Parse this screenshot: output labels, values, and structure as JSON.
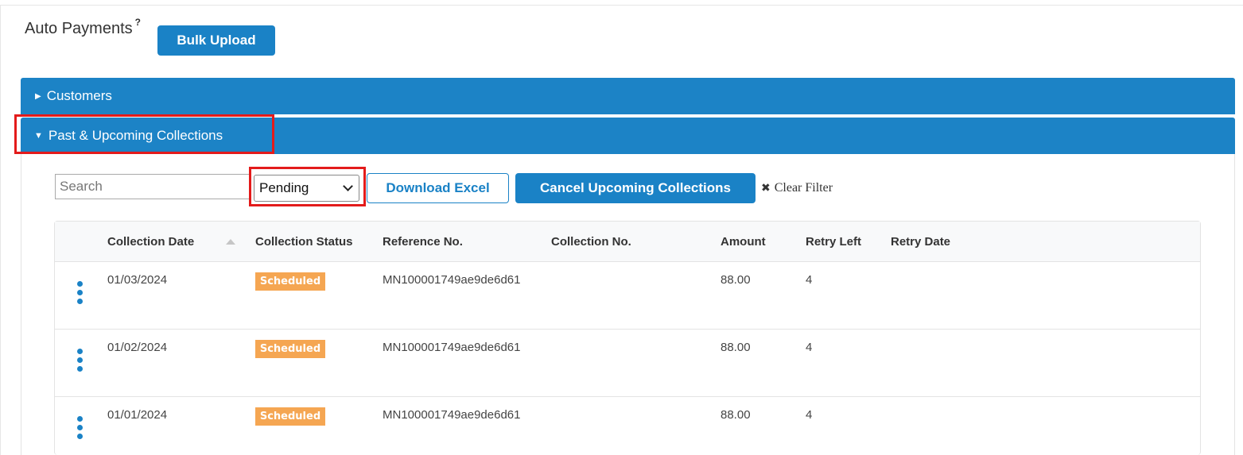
{
  "header": {
    "title": "Auto Payments",
    "help": "?",
    "bulk_upload_label": "Bulk Upload"
  },
  "accordion": {
    "customers_label": "Customers",
    "collections_label": "Past & Upcoming Collections"
  },
  "toolbar": {
    "search_placeholder": "Search",
    "status_selected": "Pending",
    "download_label": "Download Excel",
    "cancel_label": "Cancel Upcoming Collections",
    "clear_filter_label": "Clear Filter"
  },
  "table": {
    "columns": [
      "Collection Date",
      "Collection Status",
      "Reference No.",
      "Collection No.",
      "Amount",
      "Retry Left",
      "Retry Date"
    ],
    "rows": [
      {
        "date": "01/03/2024",
        "status": "Scheduled",
        "reference": "MN100001749ae9de6d61",
        "collection_no": "",
        "amount": "88.00",
        "retry_left": "4",
        "retry_date": ""
      },
      {
        "date": "01/02/2024",
        "status": "Scheduled",
        "reference": "MN100001749ae9de6d61",
        "collection_no": "",
        "amount": "88.00",
        "retry_left": "4",
        "retry_date": ""
      },
      {
        "date": "01/01/2024",
        "status": "Scheduled",
        "reference": "MN100001749ae9de6d61",
        "collection_no": "",
        "amount": "88.00",
        "retry_left": "4",
        "retry_date": ""
      }
    ]
  },
  "colors": {
    "primary": "#1a82c6",
    "badge": "#f5a652",
    "highlight": "#e31b1b"
  },
  "icons": {
    "row_menu": "kebab-icon",
    "clear": "x-icon",
    "sort": "sort-asc-icon",
    "expand": "caret-icon"
  }
}
